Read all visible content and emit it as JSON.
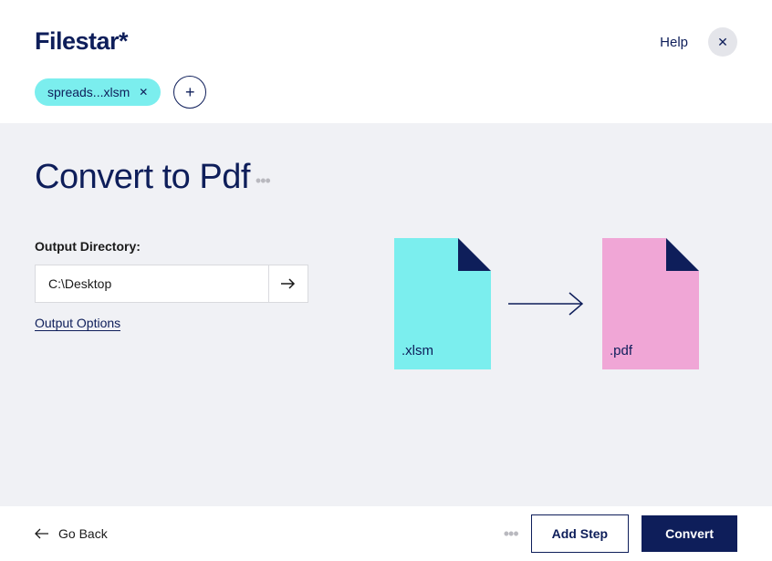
{
  "header": {
    "logo": "Filestar*",
    "help": "Help",
    "file_chip": "spreads...xlsm"
  },
  "main": {
    "title": "Convert to Pdf",
    "output_label": "Output Directory:",
    "output_dir": "C:\\Desktop",
    "output_options": "Output Options",
    "src_ext": ".xlsm",
    "dst_ext": ".pdf"
  },
  "footer": {
    "go_back": "Go Back",
    "add_step": "Add Step",
    "convert": "Convert"
  }
}
